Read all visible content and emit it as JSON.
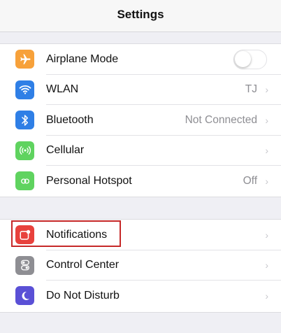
{
  "header": {
    "title": "Settings"
  },
  "colors": {
    "airplane": "#f7a13a",
    "wlan": "#2f7fe6",
    "bluetooth": "#2f7fe6",
    "cellular": "#5fd35f",
    "hotspot": "#5fd35f",
    "notifications": "#e8413c",
    "control_center": "#8e8e93",
    "dnd": "#5a50d6",
    "highlight": "#c62828"
  },
  "group1": {
    "airplane": {
      "label": "Airplane Mode",
      "icon": "airplane-icon",
      "toggle_on": false
    },
    "wlan": {
      "label": "WLAN",
      "value": "TJ",
      "icon": "wifi-icon"
    },
    "bluetooth": {
      "label": "Bluetooth",
      "value": "Not Connected",
      "icon": "bluetooth-icon"
    },
    "cellular": {
      "label": "Cellular",
      "icon": "cellular-icon"
    },
    "hotspot": {
      "label": "Personal Hotspot",
      "value": "Off",
      "icon": "hotspot-icon"
    }
  },
  "group2": {
    "notifications": {
      "label": "Notifications",
      "icon": "notifications-icon"
    },
    "control_center": {
      "label": "Control Center",
      "icon": "control-center-icon"
    },
    "dnd": {
      "label": "Do Not Disturb",
      "icon": "moon-icon"
    }
  },
  "chevron": "›"
}
